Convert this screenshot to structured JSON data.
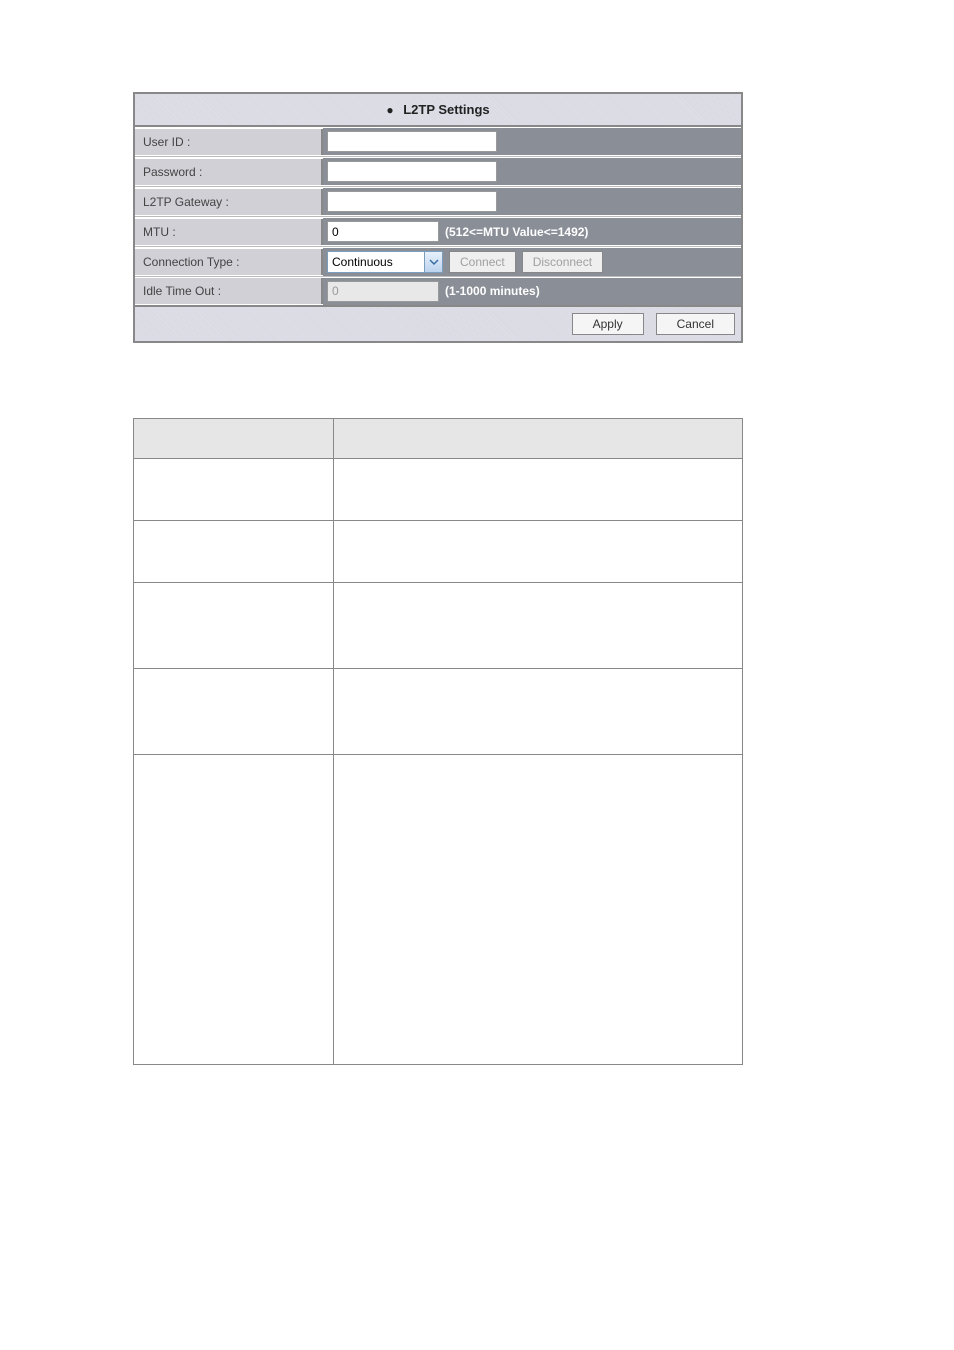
{
  "panel": {
    "title": "L2TP Settings",
    "rows": {
      "userid": {
        "label": "User ID :",
        "value": ""
      },
      "password": {
        "label": "Password :",
        "value": ""
      },
      "gateway": {
        "label": "L2TP Gateway :",
        "value": ""
      },
      "mtu": {
        "label": "MTU :",
        "value": "0",
        "hint": "(512<=MTU Value<=1492)"
      },
      "conn": {
        "label": "Connection Type :",
        "selected": "Continuous",
        "connect_btn": "Connect",
        "disconnect_btn": "Disconnect"
      },
      "idle": {
        "label": "Idle Time Out :",
        "value": "0",
        "hint": "(1-1000 minutes)"
      }
    },
    "footer": {
      "apply": "Apply",
      "cancel": "Cancel"
    }
  }
}
